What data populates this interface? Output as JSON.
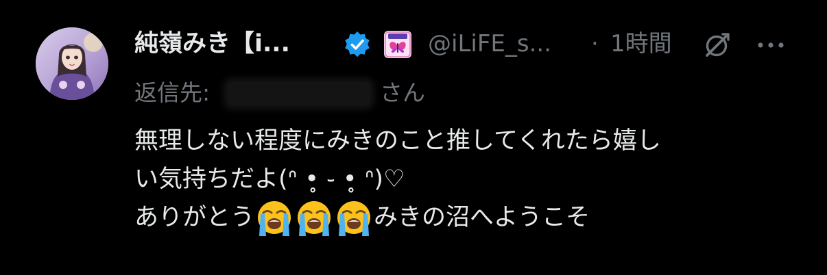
{
  "author": {
    "display_name": "純嶺みき【i...",
    "handle": "@iLiFE_s...",
    "separator": "·",
    "timestamp": "1時間"
  },
  "reply_to": {
    "label": "返信先:",
    "suffix": "さん"
  },
  "body": {
    "line1": "無理しない程度にみきのこと推してくれたら嬉し",
    "line2": "い気持ちだよ(ᐢ •̥ ֊ •̥ ᐢ)♡",
    "line3_start": "ありがとう",
    "line3_end": "みきの沼へようこそ"
  },
  "icons": {
    "verified": "verified-badge-icon",
    "affiliate": "affiliate-badge-icon",
    "grok": "grok-icon",
    "more": "more-options-icon",
    "emoji": "loudly-crying-face-emoji"
  },
  "colors": {
    "background": "#000000",
    "primary_text": "#e7e9ea",
    "secondary_text": "#71767b",
    "verified_blue": "#1d9bf0"
  }
}
